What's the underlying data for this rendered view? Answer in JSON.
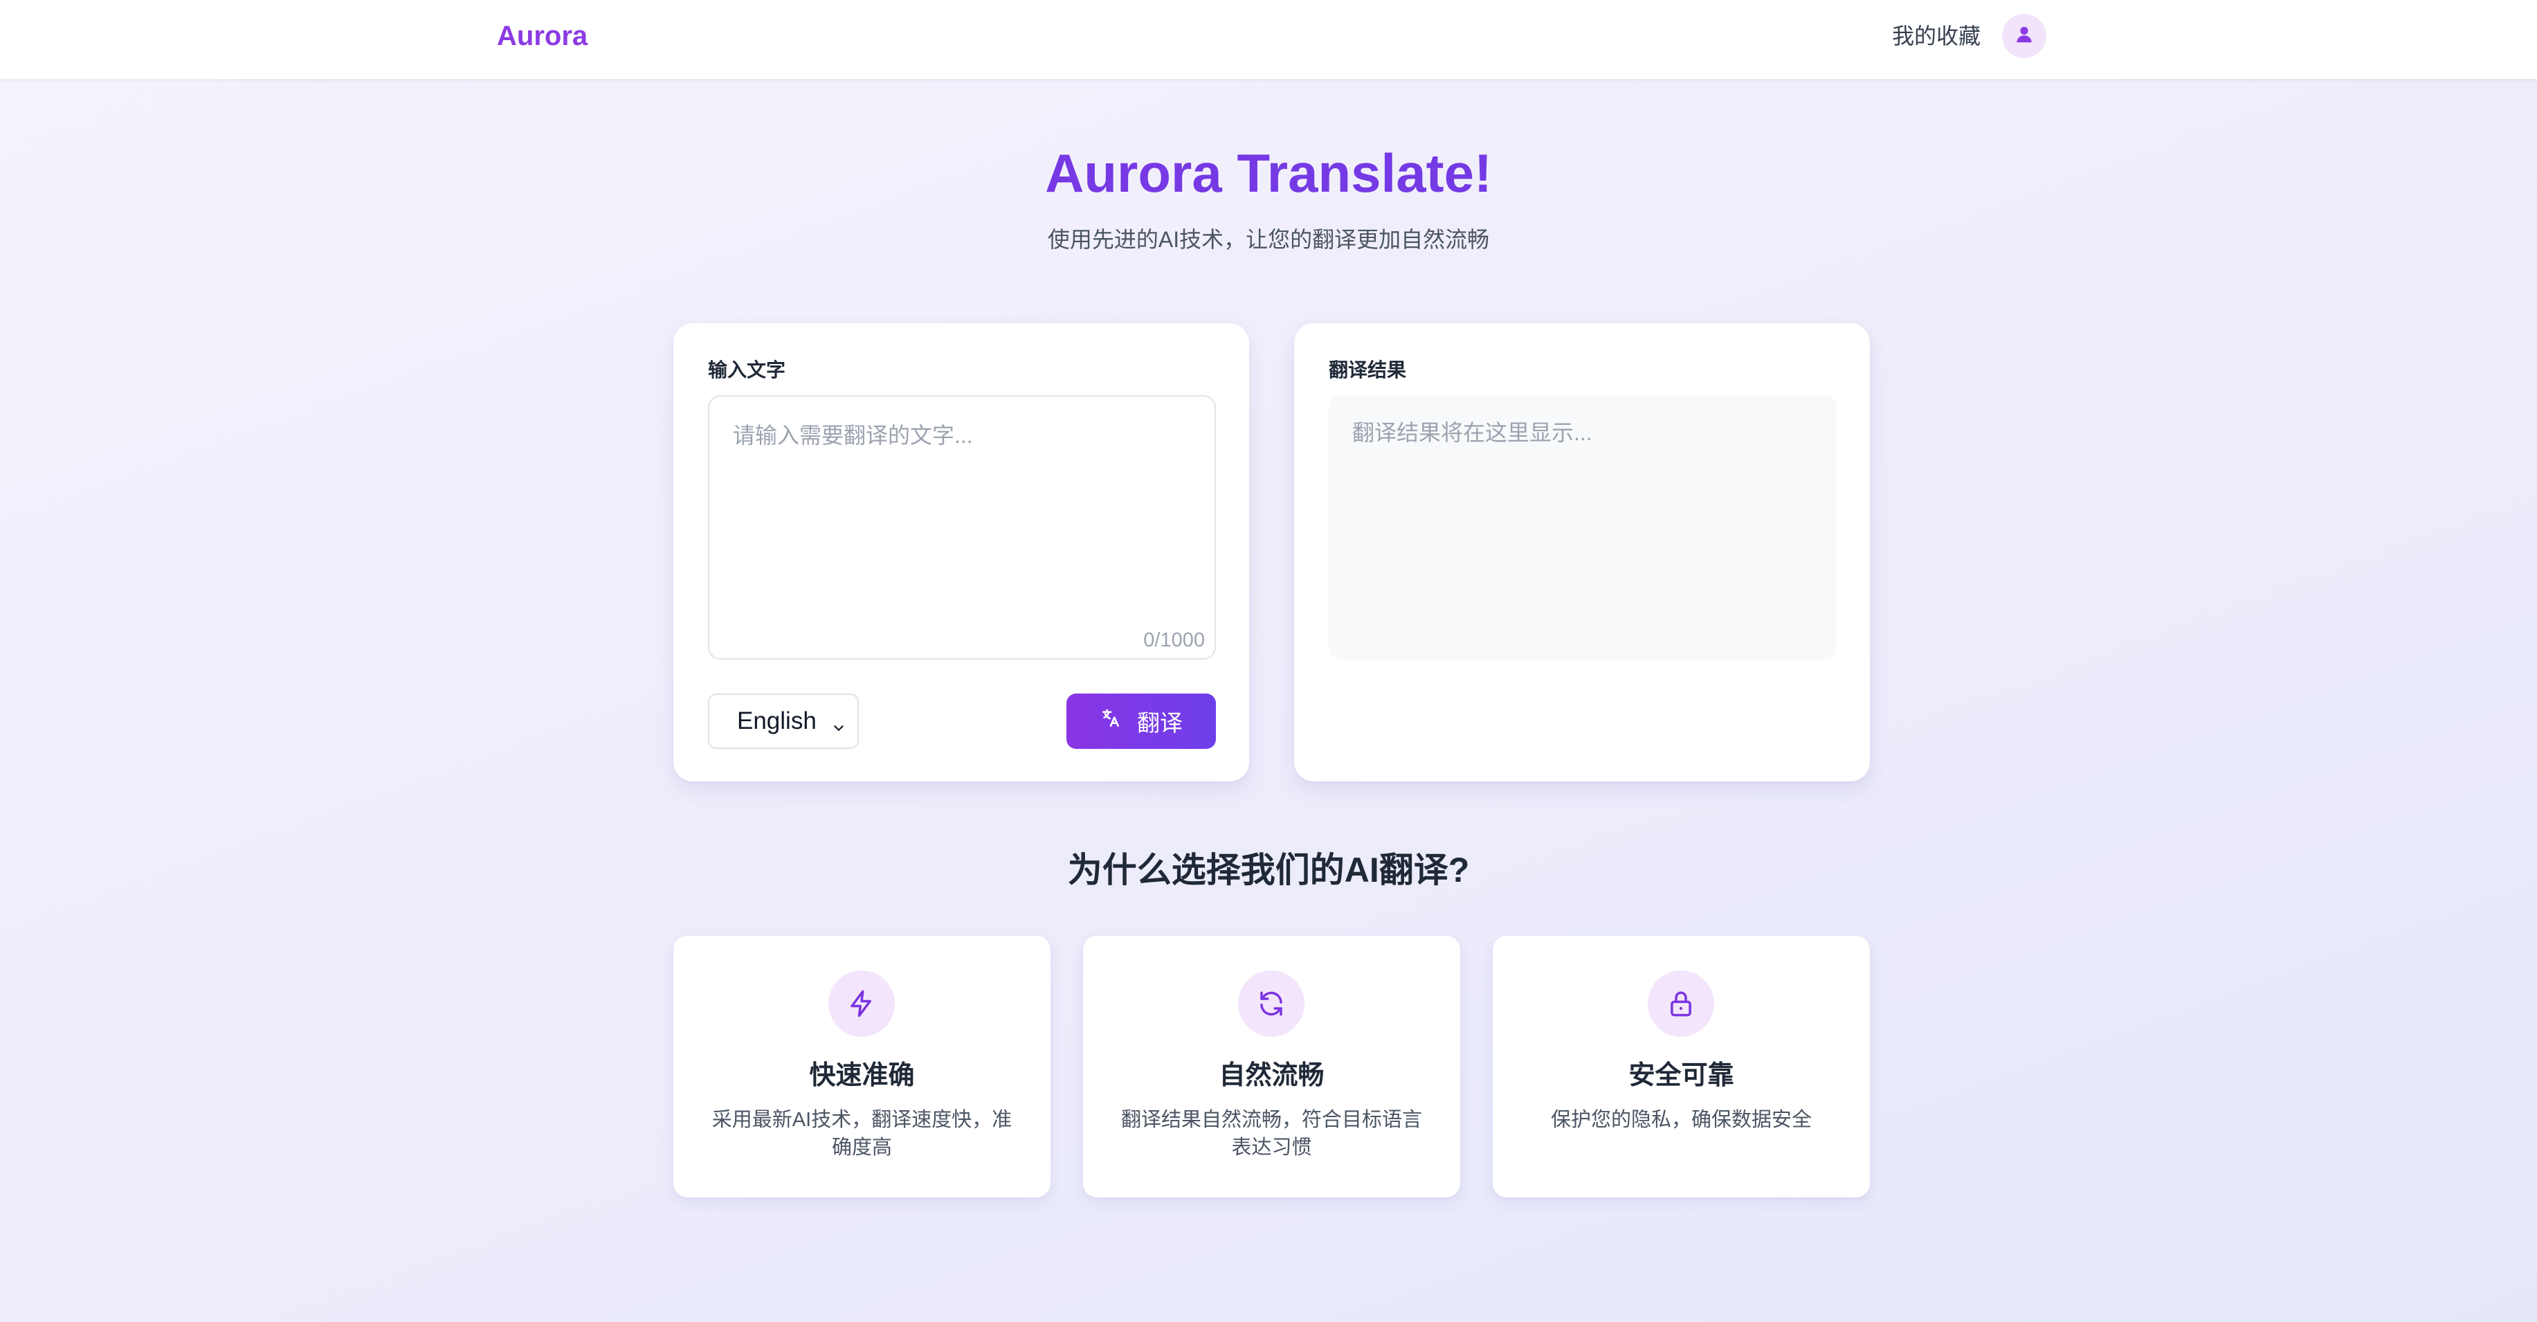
{
  "header": {
    "logo": "Aurora",
    "favorites_link": "我的收藏",
    "avatar_icon": "user-icon"
  },
  "hero": {
    "title": "Aurora Translate!",
    "subtitle": "使用先进的AI技术，让您的翻译更加自然流畅"
  },
  "input_panel": {
    "label": "输入文字",
    "placeholder": "请输入需要翻译的文字...",
    "value": "",
    "char_count": "0/1000",
    "language": {
      "selected": "English",
      "icon": "chevron-down-icon"
    },
    "translate_button": {
      "label": "翻译",
      "icon": "translate-icon"
    }
  },
  "output_panel": {
    "label": "翻译结果",
    "placeholder": "翻译结果将在这里显示..."
  },
  "features": {
    "title": "为什么选择我们的AI翻译?",
    "items": [
      {
        "icon": "lightning-icon",
        "title": "快速准确",
        "description": "采用最新AI技术，翻译速度快，准确度高"
      },
      {
        "icon": "refresh-icon",
        "title": "自然流畅",
        "description": "翻译结果自然流畅，符合目标语言表达习惯"
      },
      {
        "icon": "lock-icon",
        "title": "安全可靠",
        "description": "保护您的隐私，确保数据安全"
      }
    ]
  },
  "colors": {
    "brand": "#8b3ae3",
    "button_gradient_start": "#8a35e6",
    "button_gradient_end": "#6d3fe9",
    "icon_bg": "#f3e6fc"
  }
}
